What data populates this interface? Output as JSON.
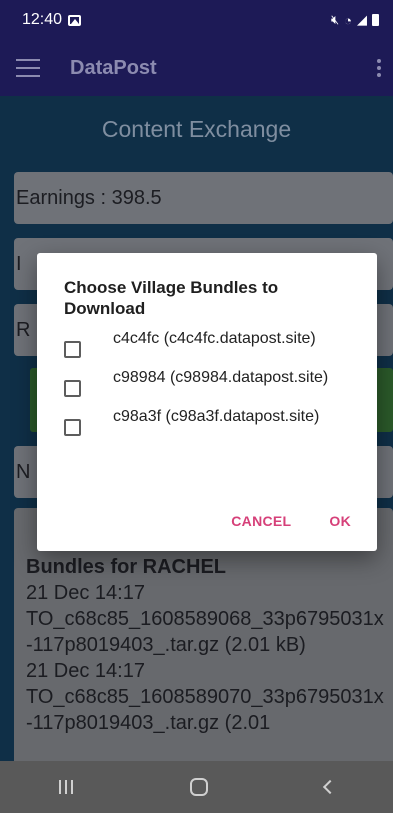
{
  "status_bar": {
    "time": "12:40"
  },
  "app_bar": {
    "title": "DataPost"
  },
  "main": {
    "section_title": "Content Exchange",
    "earnings": "Earnings : 398.5",
    "row2_text": "I",
    "row3_text": "R",
    "row4_text": "N",
    "bundles": {
      "heading": "Bundles for RACHEL",
      "entries": [
        {
          "date": "21 Dec 14:17",
          "name": "TO_c68c85_1608589068_33p6795031x-117p8019403_.tar.gz (2.01 kB)"
        },
        {
          "date": "21 Dec 14:17",
          "name": "TO_c68c85_1608589070_33p6795031x-117p8019403_.tar.gz (2.01"
        }
      ]
    }
  },
  "dialog": {
    "title": "Choose Village Bundles to Download",
    "options": [
      {
        "label": "c4c4fc (c4c4fc.datapost.site)"
      },
      {
        "label": "c98984 (c98984.datapost.site)"
      },
      {
        "label": "c98a3f (c98a3f.datapost.site)"
      }
    ],
    "cancel_label": "CANCEL",
    "ok_label": "OK"
  },
  "colors": {
    "app_bar": "#1d1a56",
    "accent": "#d64079"
  }
}
